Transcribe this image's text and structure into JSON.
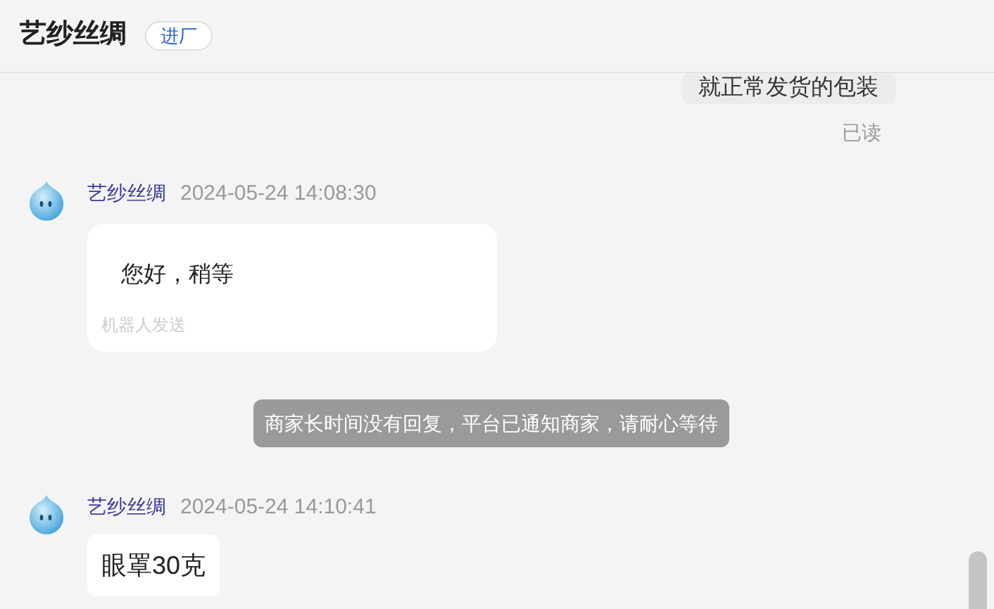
{
  "header": {
    "title": "艺纱丝绸",
    "badge": "进厂"
  },
  "messages": [
    {
      "kind": "outgoing",
      "text": "就正常发货的包装",
      "status": "已读"
    },
    {
      "kind": "incoming",
      "sender": "艺纱丝绸",
      "time": "2024-05-24 14:08:30",
      "text": "您好，稍等",
      "note": "机器人发送"
    },
    {
      "kind": "system",
      "text": "商家长时间没有回复，平台已通知商家，请耐心等待"
    },
    {
      "kind": "incoming",
      "sender": "艺纱丝绸",
      "time": "2024-05-24 14:10:41",
      "text": "眼罩30克"
    }
  ]
}
